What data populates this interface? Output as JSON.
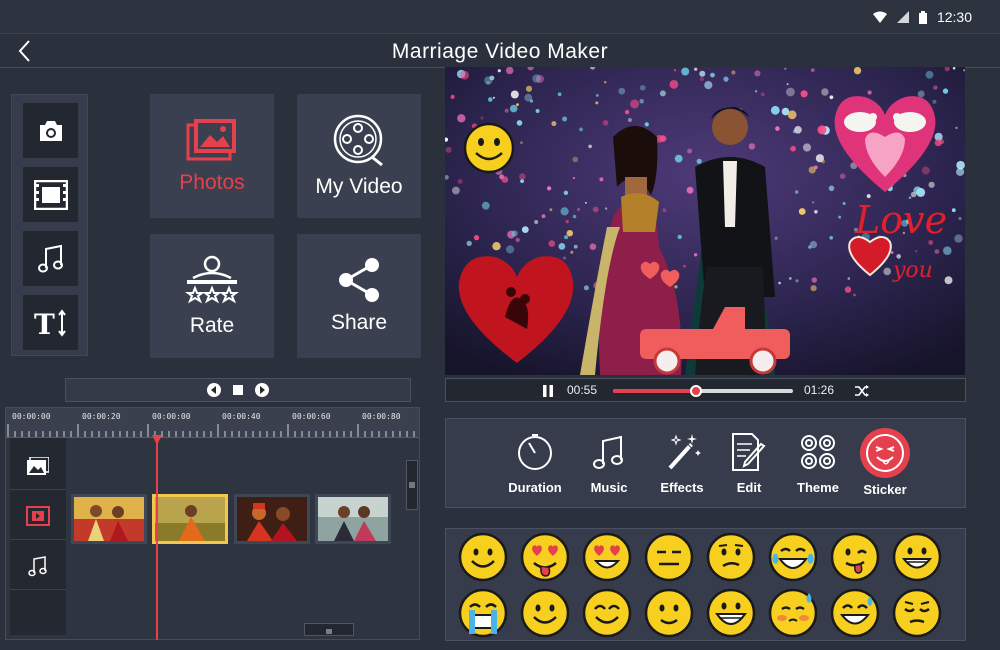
{
  "status": {
    "time": "12:30"
  },
  "app": {
    "title": "Marriage Video Maker"
  },
  "tools": [
    "camera-icon",
    "film-icon",
    "music-icon",
    "text-size-icon"
  ],
  "tiles": {
    "photos": {
      "label": "Photos",
      "color": "#e5404d"
    },
    "my_video": {
      "label": "My Video"
    },
    "rate": {
      "label": "Rate"
    },
    "share": {
      "label": "Share"
    }
  },
  "timeline": {
    "ruler_labels": [
      "00:00:00",
      "00:00:20",
      "00:00:00",
      "00:00:40",
      "00:00:60",
      "00:00:80"
    ],
    "tracks": [
      "image-track-icon",
      "video-track-icon",
      "music-track-icon"
    ],
    "clips": 4,
    "selected_clip": 2
  },
  "player": {
    "current_time": "00:55",
    "total_time": "01:26",
    "progress": 0.46
  },
  "edit_tools": [
    {
      "label": "Duration",
      "icon": "timer-icon"
    },
    {
      "label": "Music",
      "icon": "music-note-icon"
    },
    {
      "label": "Effects",
      "icon": "magic-wand-icon"
    },
    {
      "label": "Edit",
      "icon": "edit-doc-icon"
    },
    {
      "label": "Theme",
      "icon": "theme-grid-icon"
    },
    {
      "label": "Sticker",
      "icon": "sticker-face-icon",
      "active": true
    }
  ],
  "preview": {
    "sticker_text_1": "Love",
    "sticker_text_2": "you"
  },
  "colors": {
    "accent": "#e5404d",
    "background": "#2b303d",
    "panel": "#363c4b",
    "emoji_yellow": "#f7cf1f"
  }
}
